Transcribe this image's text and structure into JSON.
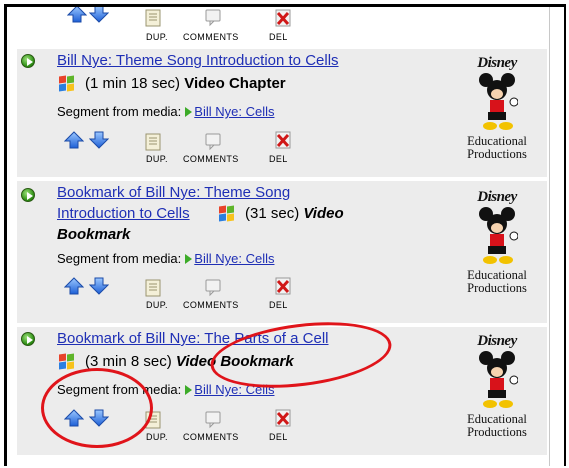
{
  "toolbar_labels": {
    "dup": "DUP.",
    "comments": "COMMENTS",
    "del": "DEL"
  },
  "items": [
    {
      "title": "Bill Nye: Theme Song Introduction to Cells",
      "duration": "(1 min 18 sec)",
      "type": "Video Chapter",
      "segment_prefix": "Segment from media:",
      "segment_link": "Bill Nye: Cells",
      "logo_brand": "Disney",
      "logo_caption_1": "Educational",
      "logo_caption_2": "Productions"
    },
    {
      "title_line_1": "Bookmark of Bill Nye: Theme Song",
      "title_line_2": "Introduction to Cells",
      "duration": "(31 sec)",
      "type_1": "Video",
      "type_2": "Bookmark",
      "segment_prefix": "Segment from media:",
      "segment_link": "Bill Nye: Cells",
      "logo_brand": "Disney",
      "logo_caption_1": "Educational",
      "logo_caption_2": "Productions"
    },
    {
      "title": "Bookmark of Bill Nye: The Parts of a Cell",
      "duration": "(3 min 8 sec)",
      "type": "Video Bookmark",
      "segment_prefix": "Segment from media:",
      "segment_link": "Bill Nye: Cells",
      "logo_brand": "Disney",
      "logo_caption_1": "Educational",
      "logo_caption_2": "Productions"
    }
  ],
  "colors": {
    "link": "#1f2fb5",
    "highlight_oval": "#e0141a",
    "panel_gray": "#ececec"
  }
}
